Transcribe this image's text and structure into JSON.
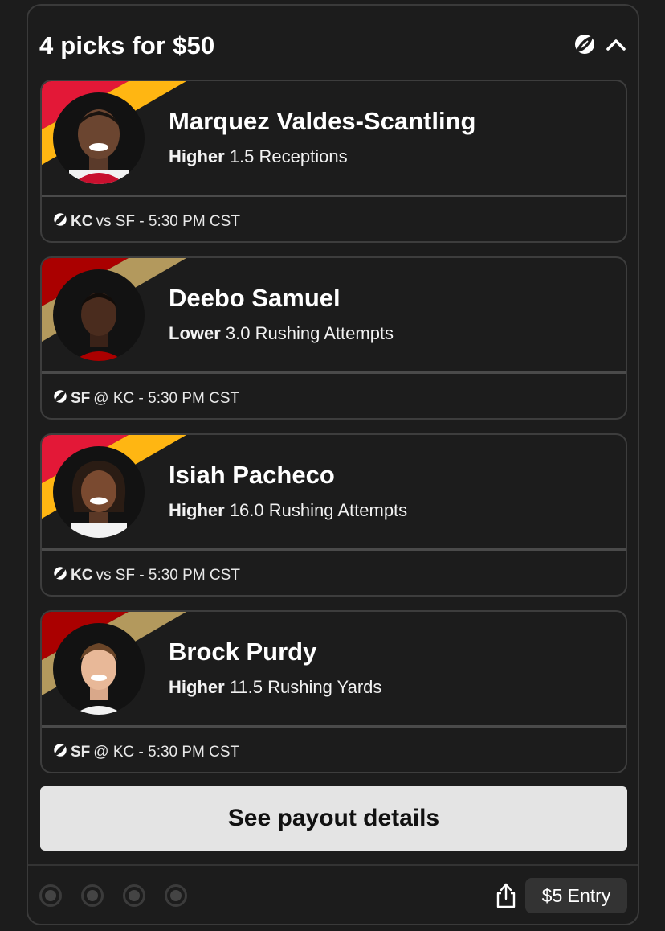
{
  "header": {
    "title": "4 picks for $50",
    "sport_icon": "football-icon",
    "collapse_icon": "chevron-up-icon"
  },
  "colors": {
    "kc_red": "#e31837",
    "kc_gold": "#ffb612",
    "sf_red": "#aa0000",
    "sf_gold": "#b3995d",
    "card_border": "#3d3d3d"
  },
  "picks": [
    {
      "name": "Marquez Valdes-Scantling",
      "direction": "Higher",
      "line": "1.5 Receptions",
      "team": "KC",
      "matchup": "vs SF - 5:30 PM CST"
    },
    {
      "name": "Deebo Samuel",
      "direction": "Lower",
      "line": "3.0 Rushing Attempts",
      "team": "SF",
      "matchup": "@ KC - 5:30 PM CST"
    },
    {
      "name": "Isiah Pacheco",
      "direction": "Higher",
      "line": "16.0 Rushing Attempts",
      "team": "KC",
      "matchup": "vs SF - 5:30 PM CST"
    },
    {
      "name": "Brock Purdy",
      "direction": "Higher",
      "line": "11.5 Rushing Yards",
      "team": "SF",
      "matchup": "@ KC - 5:30 PM CST"
    }
  ],
  "payout_button": "See payout details",
  "footer": {
    "share_icon": "share-icon",
    "entry_label": "$5 Entry"
  }
}
